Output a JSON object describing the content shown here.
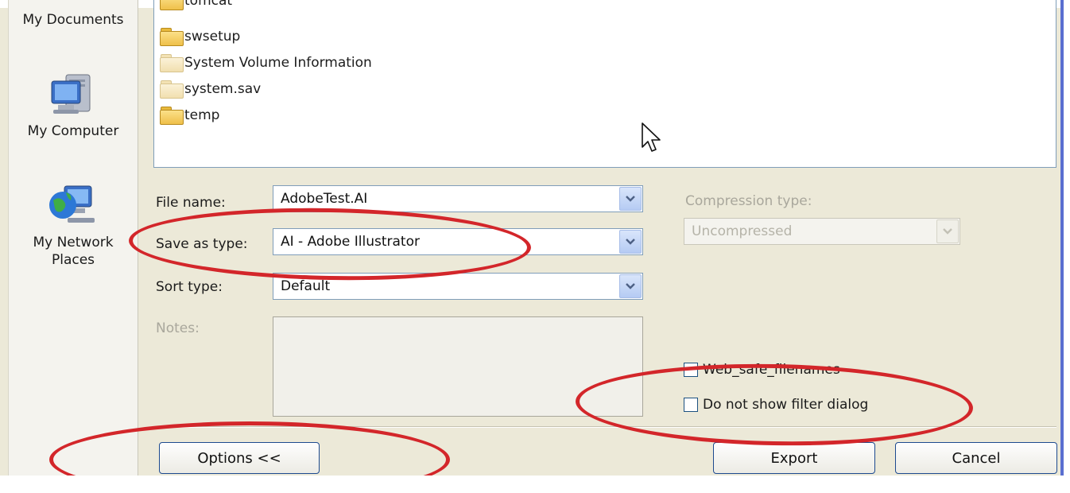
{
  "places": [
    {
      "label": "My Documents",
      "icon": "my-documents-icon"
    },
    {
      "label": "My Computer",
      "icon": "my-computer-icon"
    },
    {
      "label_line1": "My Network",
      "label_line2": "Places",
      "icon": "network-places-icon"
    }
  ],
  "files": [
    {
      "name": "tomcat",
      "style": "yellow"
    },
    {
      "name": "swsetup",
      "style": "yellow"
    },
    {
      "name": "System Volume Information",
      "style": "pale"
    },
    {
      "name": "system.sav",
      "style": "pale"
    },
    {
      "name": "temp",
      "style": "yellow"
    }
  ],
  "form": {
    "file_name_label": "File name:",
    "file_name_value": "AdobeTest.AI",
    "save_as_label": "Save as type:",
    "save_as_value": "AI - Adobe Illustrator",
    "sort_label": "Sort type:",
    "sort_value": "Default",
    "notes_label": "Notes:",
    "compression_label": "Compression type:",
    "compression_value": "Uncompressed"
  },
  "checkboxes": [
    {
      "label": "Web_safe_filenames",
      "checked": false
    },
    {
      "label": "Do not show filter dialog",
      "checked": false
    }
  ],
  "buttons": {
    "options": "Options <<",
    "export": "Export",
    "cancel": "Cancel"
  },
  "colors": {
    "highlight_ellipse": "#d3262a",
    "dialog_bg": "#ece9d8",
    "combo_button": "#b5cbf3"
  }
}
